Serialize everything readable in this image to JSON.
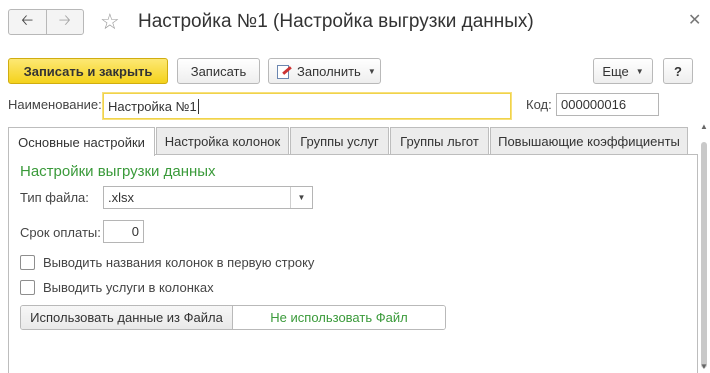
{
  "window": {
    "title": "Настройка №1 (Настройка выгрузки данных)",
    "back_icon": "arrow-left-icon",
    "forward_icon": "arrow-right-icon",
    "favorite_icon": "star-icon",
    "close_icon": "close-icon"
  },
  "toolbar": {
    "save_close_label": "Записать и закрыть",
    "save_label": "Записать",
    "fill_label": "Заполнить",
    "more_label": "Еще",
    "help_label": "?"
  },
  "fields": {
    "name_label": "Наименование:",
    "name_value": "Настройка №1",
    "code_label": "Код:",
    "code_value": "000000016"
  },
  "tabs": [
    {
      "label": "Основные настройки",
      "active": true
    },
    {
      "label": "Настройка колонок",
      "active": false
    },
    {
      "label": "Группы услуг",
      "active": false
    },
    {
      "label": "Группы льгот",
      "active": false
    },
    {
      "label": "Повышающие коэффициенты",
      "active": false
    }
  ],
  "main": {
    "section_title": "Настройки выгрузки данных",
    "file_type_label": "Тип файла:",
    "file_type_value": ".xlsx",
    "payment_term_label": "Срок оплаты:",
    "payment_term_value": "0",
    "checkbox_headers_label": "Выводить названия колонок в первую строку",
    "checkbox_headers_checked": false,
    "checkbox_services_label": "Выводить услуги в колонках",
    "checkbox_services_checked": false,
    "use_file_data_label": "Использовать данные из Файла",
    "dont_use_file_label": "Не использовать Файл"
  },
  "colors": {
    "accent_yellow": "#f4d21c",
    "section_green": "#3a9a3a"
  }
}
